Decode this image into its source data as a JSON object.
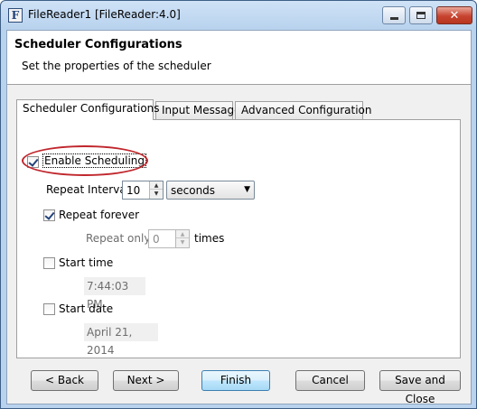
{
  "window": {
    "title": "FileReader1 [FileReader:4.0]",
    "app_icon_glyph": "F",
    "icons": {
      "minimize": "minimize-icon",
      "maximize": "maximize-icon",
      "close": "close-icon"
    },
    "close_glyph": "✕"
  },
  "header": {
    "title": "Scheduler Configurations",
    "subtitle": "Set the properties of the scheduler"
  },
  "tabs": [
    {
      "label": "Scheduler Configurations",
      "active": true
    },
    {
      "label": "Input Message",
      "active": false
    },
    {
      "label": "Advanced Configuration",
      "active": false
    }
  ],
  "scheduler": {
    "enable_label": "Enable Scheduling",
    "enable_checked": true,
    "repeat_interval_label": "Repeat Interval:",
    "repeat_interval_value": "10",
    "interval_unit": "seconds",
    "repeat_forever_label": "Repeat forever",
    "repeat_forever_checked": true,
    "repeat_only_label": "Repeat only",
    "repeat_only_value": "0",
    "times_label": "times",
    "start_time_label": "Start time",
    "start_time_checked": false,
    "start_time_value": "7:44:03 PM",
    "start_date_label": "Start date",
    "start_date_checked": false,
    "start_date_value": "April 21, 2014"
  },
  "buttons": {
    "back": "< Back",
    "next": "Next >",
    "finish": "Finish",
    "cancel": "Cancel",
    "save_close": "Save and Close"
  },
  "colors": {
    "highlight_oval": "#c0272d",
    "title_gradient": "#b9d3ee",
    "close_button": "#c7432f"
  }
}
